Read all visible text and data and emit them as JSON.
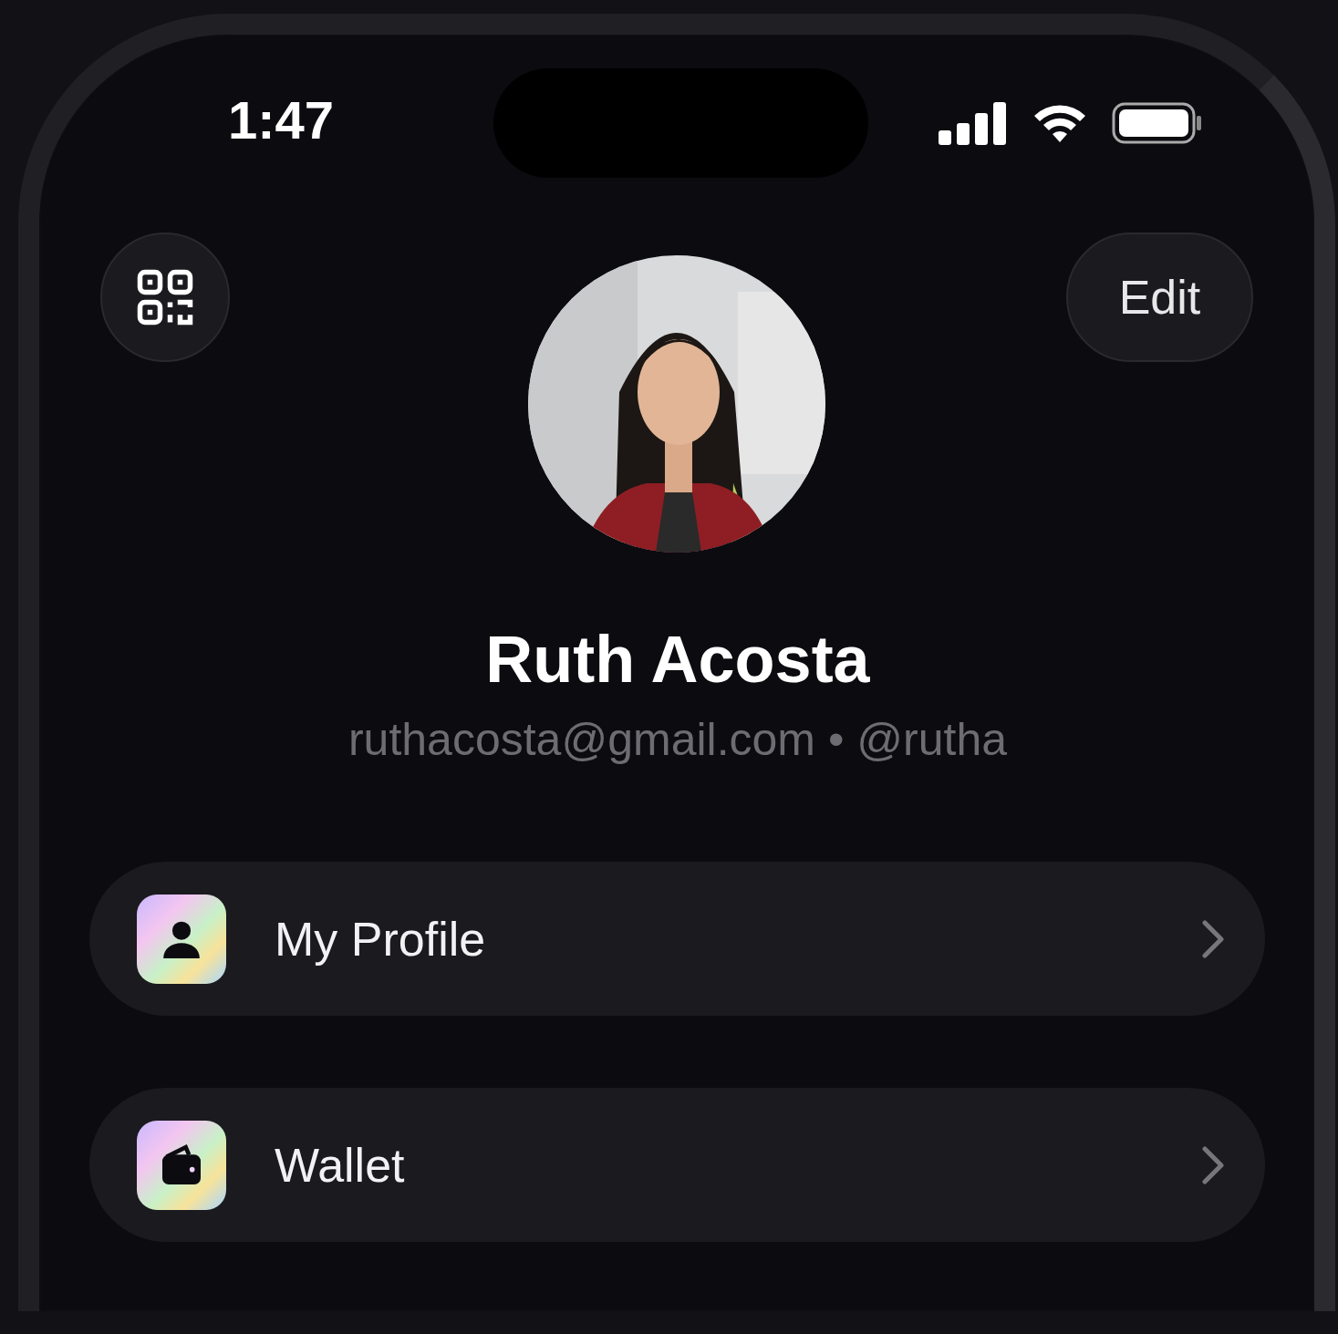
{
  "status_bar": {
    "time": "1:47"
  },
  "header": {
    "edit_button": "Edit"
  },
  "profile": {
    "name": "Ruth Acosta",
    "subtitle": "ruthacosta@gmail.com • @rutha"
  },
  "menu": [
    {
      "label": "My Profile",
      "kind": "person"
    },
    {
      "label": "Wallet",
      "kind": "wallet"
    }
  ]
}
